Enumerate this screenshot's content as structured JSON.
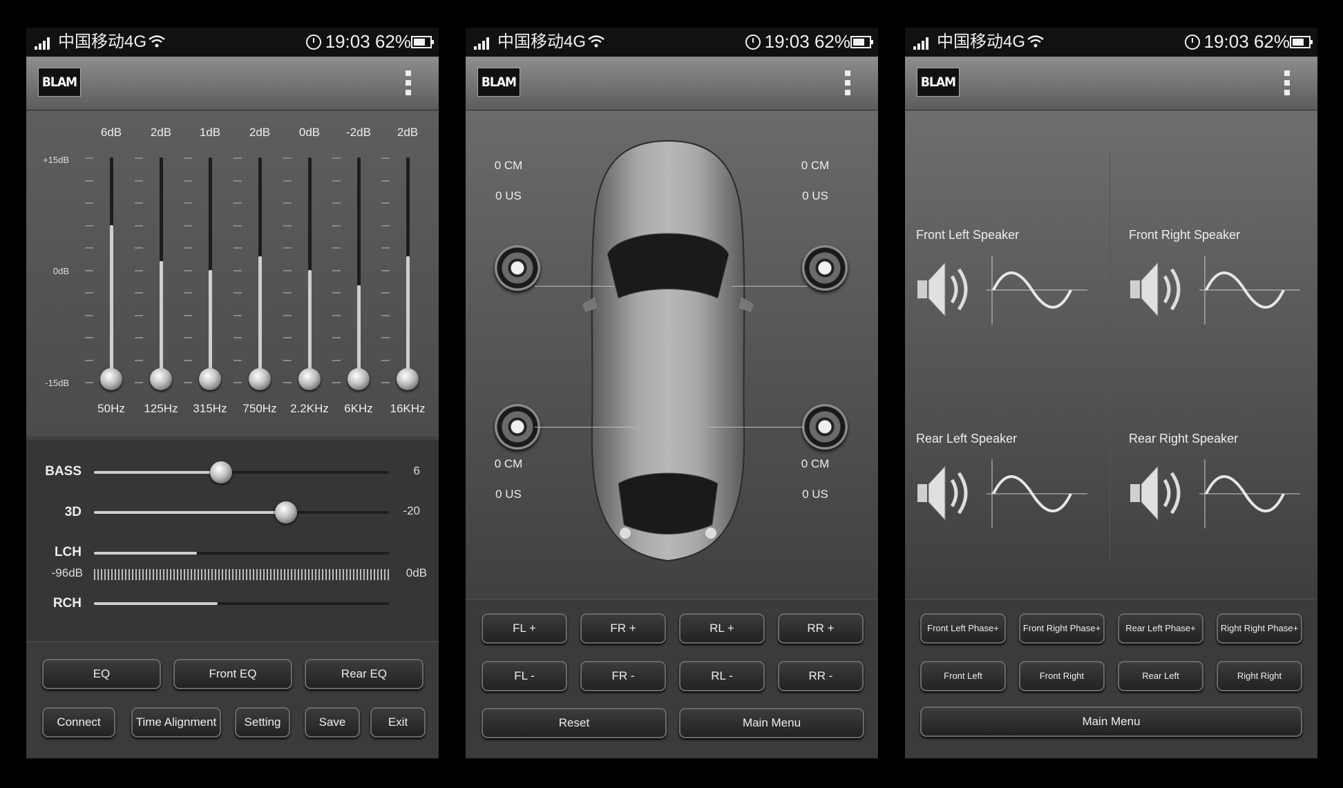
{
  "status": {
    "carrier": "中国移动4G",
    "time": "19:03",
    "battery": "62%"
  },
  "logo": "BLAM",
  "eq": {
    "db_scale": [
      "+15dB",
      "0dB",
      "-15dB"
    ],
    "bands": [
      {
        "freq": "50Hz",
        "gain": "6dB",
        "level": 0.7
      },
      {
        "freq": "125Hz",
        "gain": "2dB",
        "level": 0.54
      },
      {
        "freq": "315Hz",
        "gain": "1dB",
        "level": 0.5
      },
      {
        "freq": "750Hz",
        "gain": "2dB",
        "level": 0.56
      },
      {
        "freq": "2.2KHz",
        "gain": "0dB",
        "level": 0.5
      },
      {
        "freq": "6KHz",
        "gain": "-2dB",
        "level": 0.43
      },
      {
        "freq": "16KHz",
        "gain": "2dB",
        "level": 0.56
      }
    ]
  },
  "controls": {
    "bass": {
      "label": "BASS",
      "value": "6",
      "level": 0.43
    },
    "d3": {
      "label": "3D",
      "value": "-20",
      "level": 0.65
    },
    "lch": {
      "label": "LCH",
      "level": 0.35
    },
    "range": {
      "min": "-96dB",
      "max": "0dB"
    },
    "rch": {
      "label": "RCH",
      "level": 0.42
    }
  },
  "panel1_buttons": {
    "eq": "EQ",
    "front_eq": "Front EQ",
    "rear_eq": "Rear EQ",
    "connect": "Connect",
    "time_alignment": "Time Alignment",
    "setting": "Setting",
    "save": "Save",
    "exit": "Exit"
  },
  "alignment": {
    "fl": {
      "cm": "0 CM",
      "us": "0 US"
    },
    "fr": {
      "cm": "0 CM",
      "us": "0 US"
    },
    "rl": {
      "cm": "0 CM",
      "us": "0 US"
    },
    "rr": {
      "cm": "0 CM",
      "us": "0 US"
    }
  },
  "panel2_buttons": {
    "fl_plus": "FL +",
    "fr_plus": "FR +",
    "rl_plus": "RL +",
    "rr_plus": "RR +",
    "fl_minus": "FL -",
    "fr_minus": "FR -",
    "rl_minus": "RL -",
    "rr_minus": "RR -",
    "reset": "Reset",
    "main_menu": "Main Menu"
  },
  "phase": {
    "front_left": "Front Left Speaker",
    "front_right": "Front Right Speaker",
    "rear_left": "Rear Left Speaker",
    "rear_right": "Rear Right Speaker"
  },
  "panel3_buttons": {
    "flp": "Front Left Phase+",
    "frp": "Front Right Phase+",
    "rlp": "Rear Left Phase+",
    "rrp": "Right Right Phase+",
    "fl": "Front Left",
    "fr": "Front Right",
    "rl": "Rear Left",
    "rr": "Right Right",
    "main_menu": "Main Menu"
  }
}
